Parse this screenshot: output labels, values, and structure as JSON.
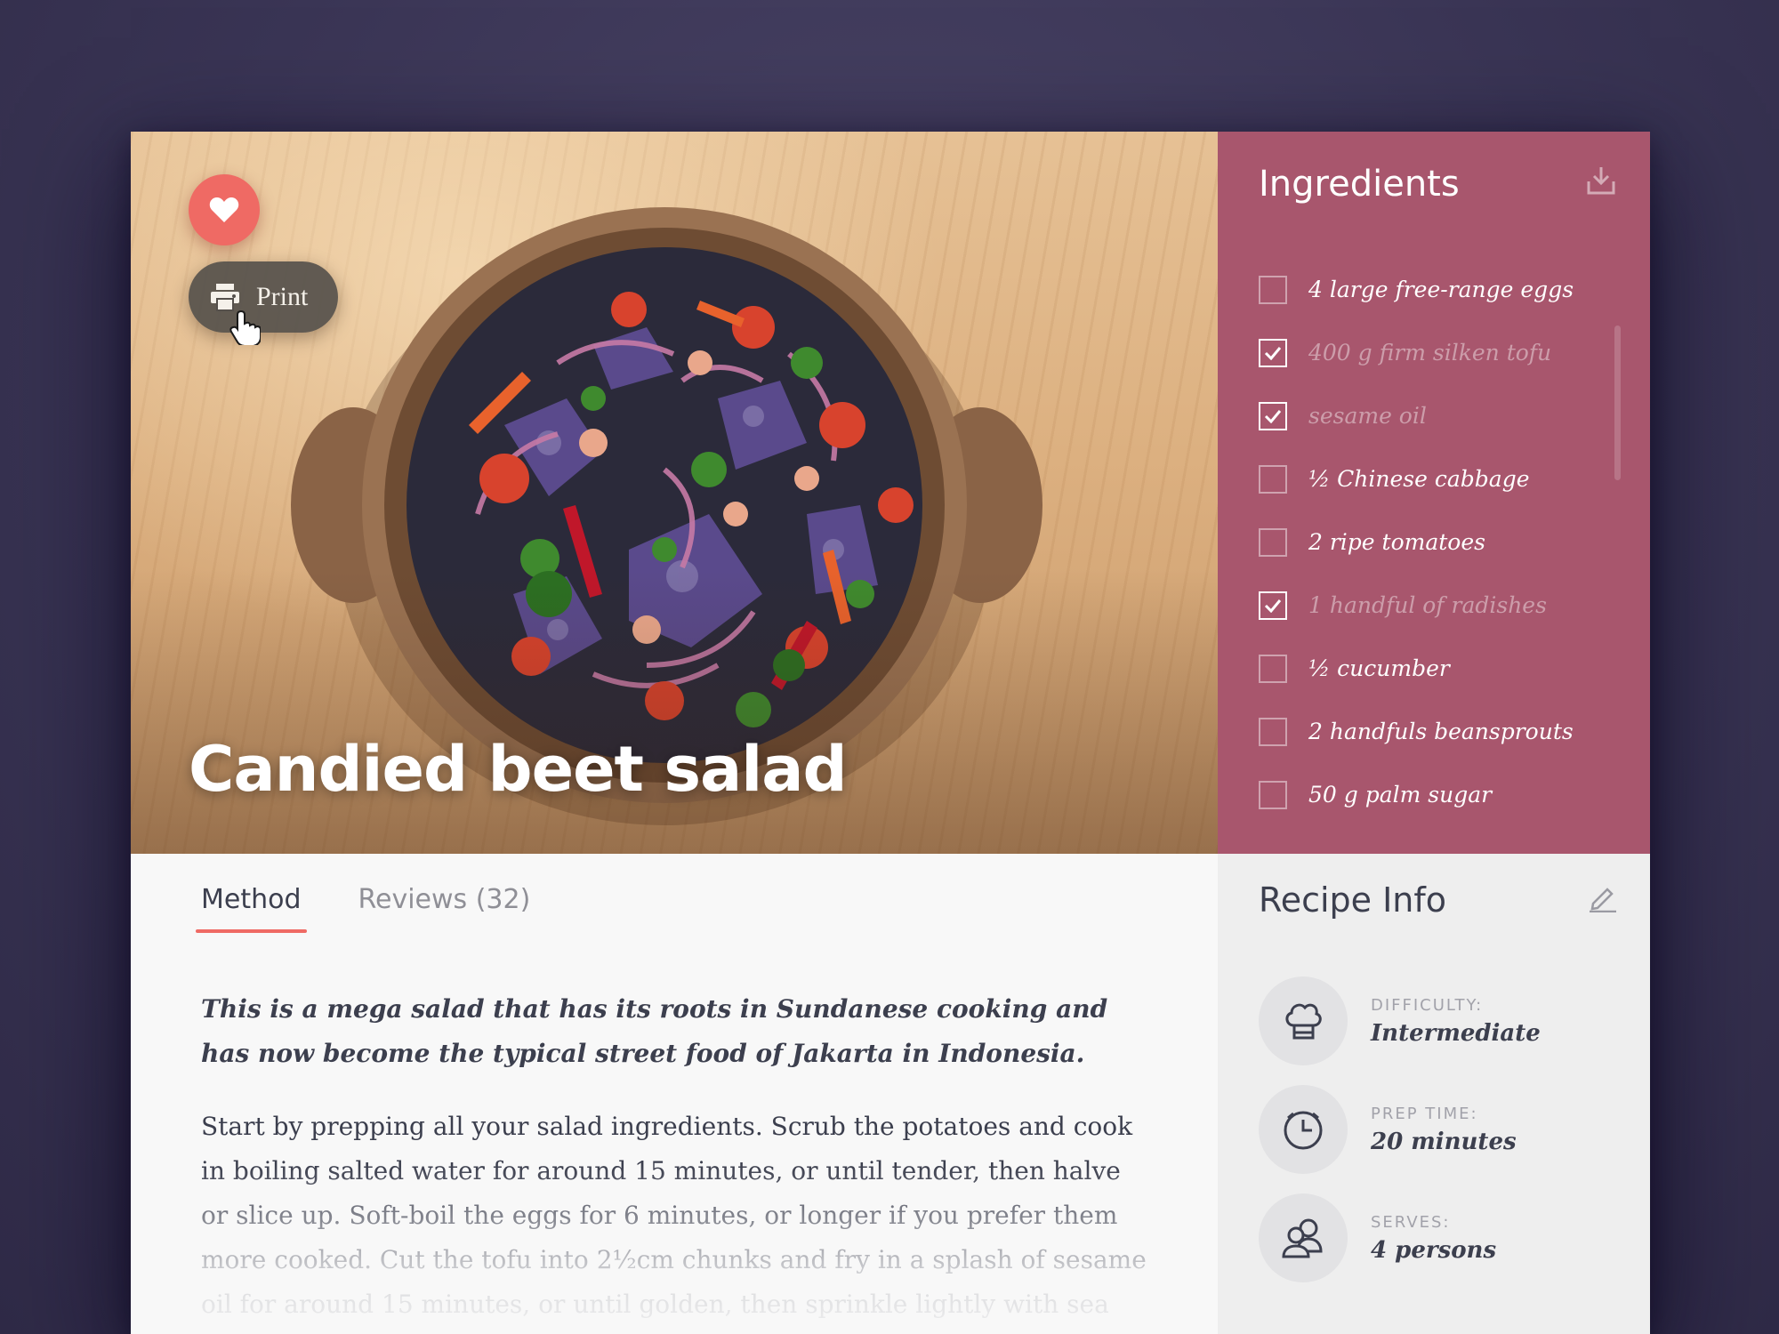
{
  "hero": {
    "title": "Candied beet salad",
    "print_label": "Print"
  },
  "ingredients": {
    "title": "Ingredients",
    "items": [
      {
        "text": "4 large free-range eggs",
        "checked": false
      },
      {
        "text": "400 g firm silken tofu",
        "checked": true
      },
      {
        "text": "sesame oil",
        "checked": true
      },
      {
        "text": "½ Chinese cabbage",
        "checked": false
      },
      {
        "text": "2 ripe tomatoes",
        "checked": false
      },
      {
        "text": "1 handful of radishes",
        "checked": true
      },
      {
        "text": "½ cucumber",
        "checked": false
      },
      {
        "text": "2 handfuls beansprouts",
        "checked": false
      },
      {
        "text": "50 g palm sugar",
        "checked": false
      }
    ]
  },
  "tabs": [
    {
      "label": "Method",
      "active": true
    },
    {
      "label": "Reviews (32)",
      "active": false
    }
  ],
  "method": {
    "lead": "This is a mega salad that has its roots in Sundanese cooking and has now become the typical street food of Jakarta in Indonesia.",
    "body": "Start by prepping all your salad ingredients. Scrub the potatoes and cook in boiling salted water for around 15 minutes, or until tender, then halve or slice up. Soft-boil the eggs for 6 minutes, or longer if you prefer them more cooked. Cut the tofu into 2½cm chunks and fry in a splash of sesame oil for around 15 minutes, or until golden, then sprinkle lightly with sea salt. Finely"
  },
  "recipe_info": {
    "title": "Recipe Info",
    "difficulty_label": "DIFFICULTY:",
    "difficulty_value": "Intermediate",
    "prep_label": "PREP TIME:",
    "prep_value": "20 minutes",
    "serves_label": "SERVES:",
    "serves_value": "4 persons"
  },
  "colors": {
    "accent": "#ef6a64",
    "ingredients_bg": "#a8566d",
    "text_dark": "#3c3f4e"
  },
  "icons": [
    "heart-icon",
    "printer-icon",
    "hand-cursor-icon",
    "download-icon",
    "check-icon",
    "edit-icon",
    "chef-hat-icon",
    "clock-icon",
    "users-icon"
  ]
}
